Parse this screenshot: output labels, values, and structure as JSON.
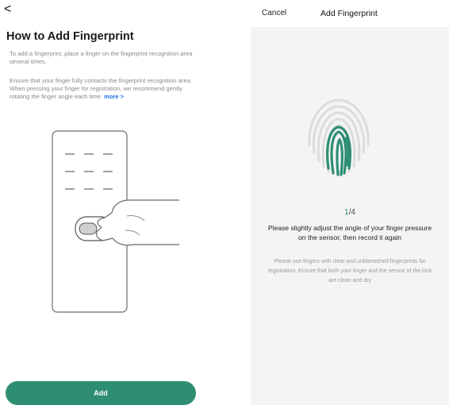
{
  "left": {
    "back_icon": "chevron-left-icon",
    "back_glyph": "<",
    "title": "How to Add Fingerprint",
    "paragraph1": "To add a fingerprint, place a finger on the fingerprint recognition area several times.",
    "paragraph2": "Ensure that your finger fully contacts the fingerprint recognition area.  When pressing your finger for registration, we recommend gently rotating the finger angle each time.",
    "more_link": "more >",
    "add_button": "Add"
  },
  "right": {
    "cancel": "Cancel",
    "title": "Add Fingerprint",
    "progress_current": "1",
    "progress_total": "/4",
    "main_message": "Please slightly adjust the angle of your finger pressure on the sensor, then record it again",
    "sub_message": "Please use fingers with clear and unblemished fingerprints for registration. Ensure that both your finger and the sensor of the lock are clean and dry",
    "progress_fraction": 0.25
  },
  "colors": {
    "accent": "#2e8e73",
    "link": "#1f6feb",
    "right_panel_bg": "#f4f4f4"
  }
}
